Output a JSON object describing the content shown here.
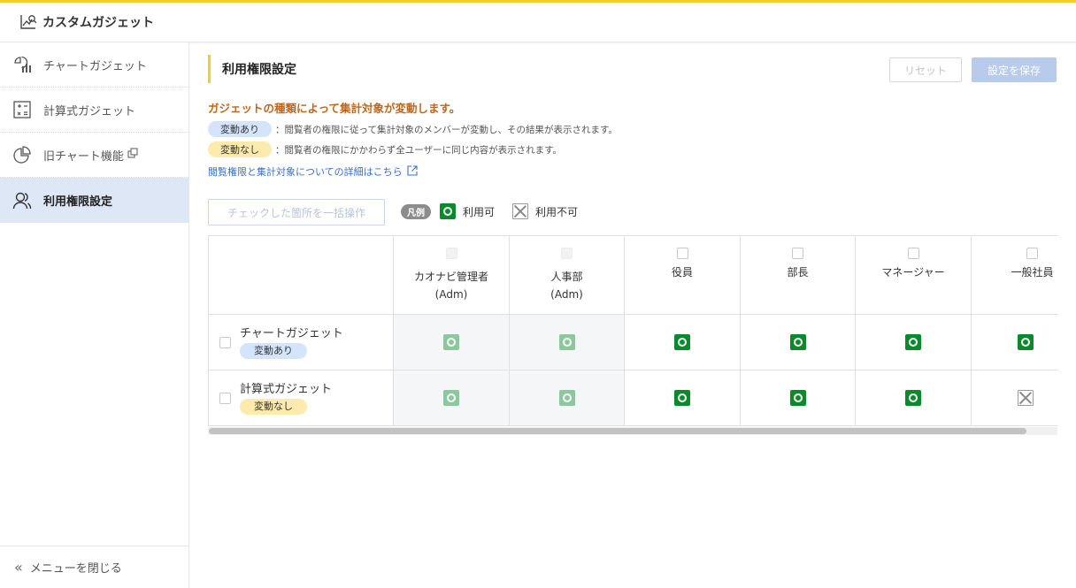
{
  "header": {
    "title": "カスタムガジェット",
    "logo_icon": "custom-gadget-icon"
  },
  "sidebar": {
    "items": [
      {
        "label": "チャートガジェット",
        "icon": "chart-gadget-icon"
      },
      {
        "label": "計算式ガジェット",
        "icon": "calculator-icon"
      },
      {
        "label": "旧チャート機能",
        "icon": "pie-chart-icon"
      },
      {
        "label": "利用権限設定",
        "icon": "users-icon"
      }
    ],
    "active": "利用権限設定",
    "collapse_label": "メニューを閉じる"
  },
  "main": {
    "title": "利用権限設定",
    "reset_label": "リセット",
    "save_label": "設定を保存",
    "warning": "ガジェットの種類によって集計対象が変動します。",
    "legend_lines": [
      {
        "tag": "変動あり",
        "text": "：閲覧者の権限に従って集計対象のメンバーが変動し、その結果が表示されます。"
      },
      {
        "tag": "変動なし",
        "text": "：閲覧者の権限にかかわらず全ユーザーに同じ内容が表示されます。"
      }
    ],
    "detail_link": "閲覧権限と集計対象についての詳細はこちら",
    "bulk_button": "チェックした箇所を一括操作",
    "legend_tag": "凡例",
    "legend_ok": "利用可",
    "legend_ng": "利用不可",
    "columns": [
      {
        "name": "カオナビ管理者",
        "sub": "(Adm)"
      },
      {
        "name": "人事部",
        "sub": "(Adm)"
      },
      {
        "name": "役員",
        "sub": ""
      },
      {
        "name": "部長",
        "sub": ""
      },
      {
        "name": "マネージャー",
        "sub": ""
      },
      {
        "name": "一般社員",
        "sub": ""
      }
    ],
    "rows": [
      {
        "name": "チャートガジェット",
        "tag": "変動あり"
      },
      {
        "name": "計算式ガジェット",
        "tag": "変動なし"
      }
    ]
  },
  "colors": {
    "accent": "#f5cc2b",
    "ok_green": "#0a8a2b",
    "link_blue": "#3a6fc8",
    "warning_orange": "#c0661b"
  }
}
